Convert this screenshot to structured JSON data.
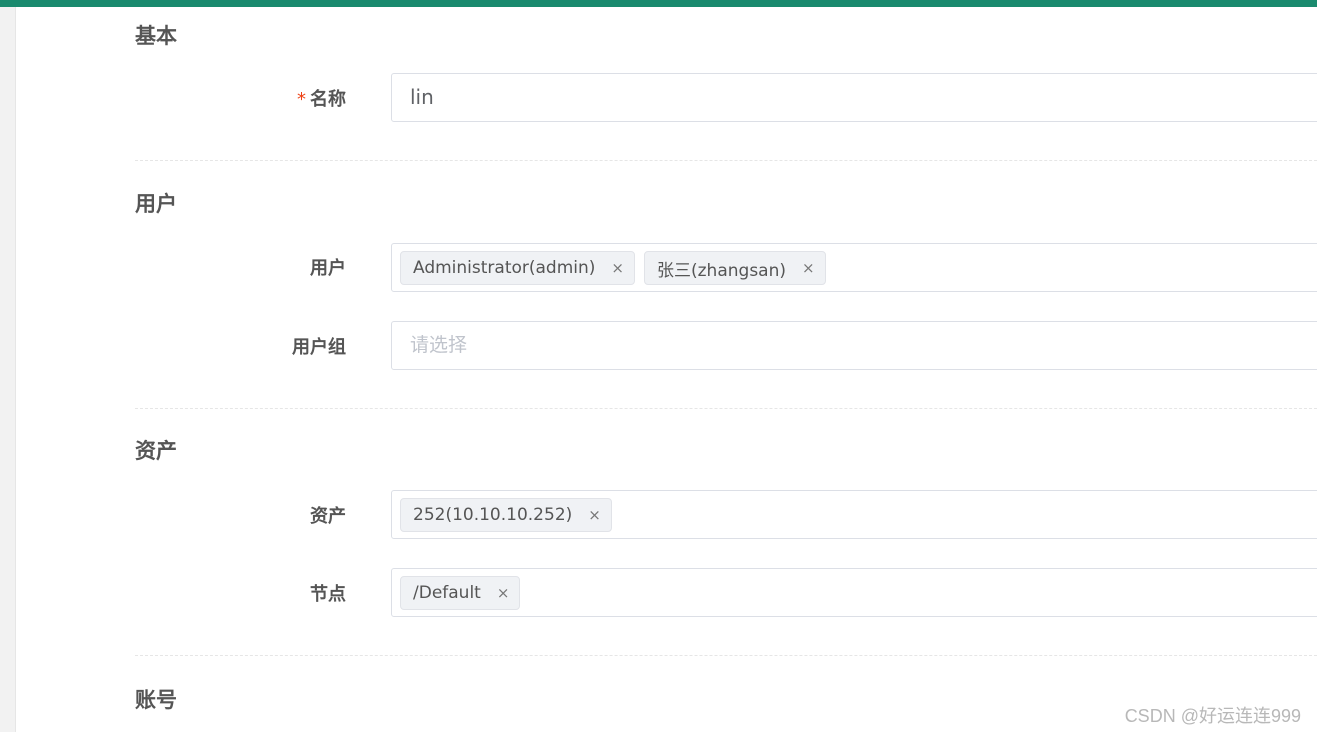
{
  "colors": {
    "accent": "#1a8a6e",
    "required": "#ed4014"
  },
  "sections": {
    "basic": {
      "title": "基本"
    },
    "users": {
      "title": "用户"
    },
    "assets": {
      "title": "资产"
    },
    "accounts": {
      "title": "账号"
    }
  },
  "fields": {
    "name": {
      "label": "名称",
      "required_mark": "*",
      "value": "lin"
    },
    "user": {
      "label": "用户",
      "tags": [
        "Administrator(admin)",
        "张三(zhangsan)"
      ]
    },
    "user_group": {
      "label": "用户组",
      "placeholder": "请选择"
    },
    "asset": {
      "label": "资产",
      "tags": [
        "252(10.10.10.252)"
      ]
    },
    "node": {
      "label": "节点",
      "tags": [
        "/Default"
      ]
    }
  },
  "tag_remove_glyph": "×",
  "watermark": "CSDN @好运连连999"
}
